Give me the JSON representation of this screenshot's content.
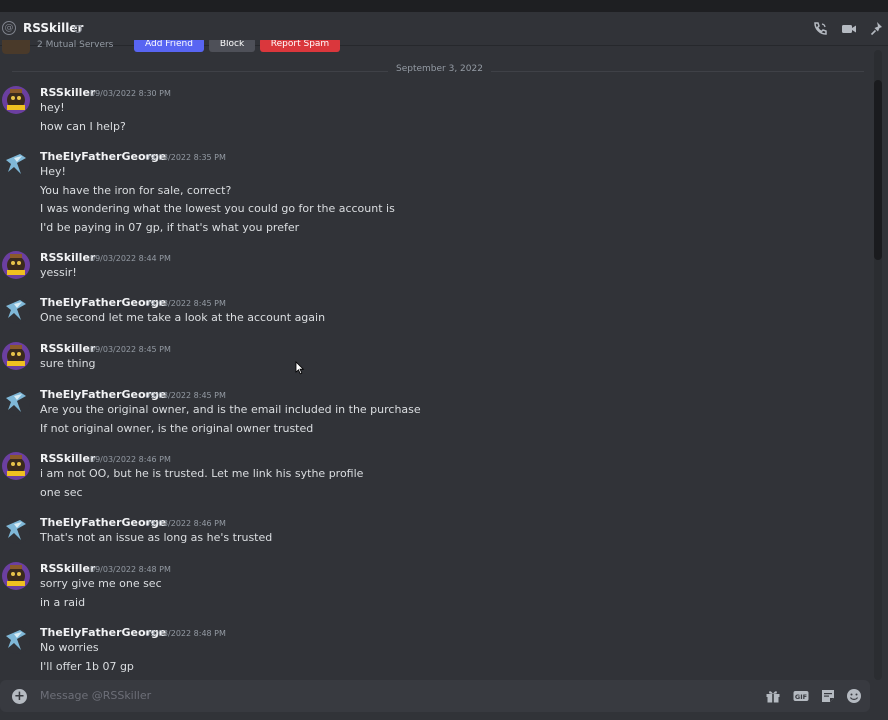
{
  "header": {
    "title": "RSSkiller"
  },
  "intro": {
    "mutual_servers": "2 Mutual Servers",
    "add_friend": "Add Friend",
    "block": "Block",
    "report_spam": "Report Spam"
  },
  "date_divider": "September 3, 2022",
  "messages": [
    {
      "author": "RSSkiller",
      "time": "09/03/2022 8:30 PM",
      "lines": [
        "hey!",
        "how can I help?"
      ]
    },
    {
      "author": "TheElyFatherGeorge",
      "time": "09/03/2022 8:35 PM",
      "lines": [
        "Hey!",
        "You have the iron for sale, correct?",
        "I was wondering what the lowest you could go for the account is",
        "I'd be paying in 07 gp, if that's what you prefer"
      ]
    },
    {
      "author": "RSSkiller",
      "time": "09/03/2022 8:44 PM",
      "lines": [
        "yessir!"
      ]
    },
    {
      "author": "TheElyFatherGeorge",
      "time": "09/03/2022 8:45 PM",
      "lines": [
        "One second let me take a look at the account again"
      ]
    },
    {
      "author": "RSSkiller",
      "time": "09/03/2022 8:45 PM",
      "lines": [
        "sure thing"
      ]
    },
    {
      "author": "TheElyFatherGeorge",
      "time": "09/03/2022 8:45 PM",
      "lines": [
        "Are you the original owner, and is the email included in the purchase",
        "If not original owner, is the original owner trusted"
      ]
    },
    {
      "author": "RSSkiller",
      "time": "09/03/2022 8:46 PM",
      "lines": [
        "i am not OO, but he is trusted. Let me link his sythe profile",
        "one sec"
      ]
    },
    {
      "author": "TheElyFatherGeorge",
      "time": "09/03/2022 8:46 PM",
      "lines": [
        "That's not an issue as long as he's trusted"
      ]
    },
    {
      "author": "RSSkiller",
      "time": "09/03/2022 8:48 PM",
      "lines": [
        "sorry give me one sec",
        "in a raid"
      ]
    },
    {
      "author": "TheElyFatherGeorge",
      "time": "09/03/2022 8:48 PM",
      "lines": [
        "No worries",
        "I'll offer 1b 07 gp"
      ]
    }
  ],
  "composer": {
    "placeholder": "Message @RSSkiller"
  },
  "colors": {
    "background": "#313338",
    "add_friend": "#5865f2",
    "block": "#4e5058",
    "report_spam": "#da373c"
  }
}
